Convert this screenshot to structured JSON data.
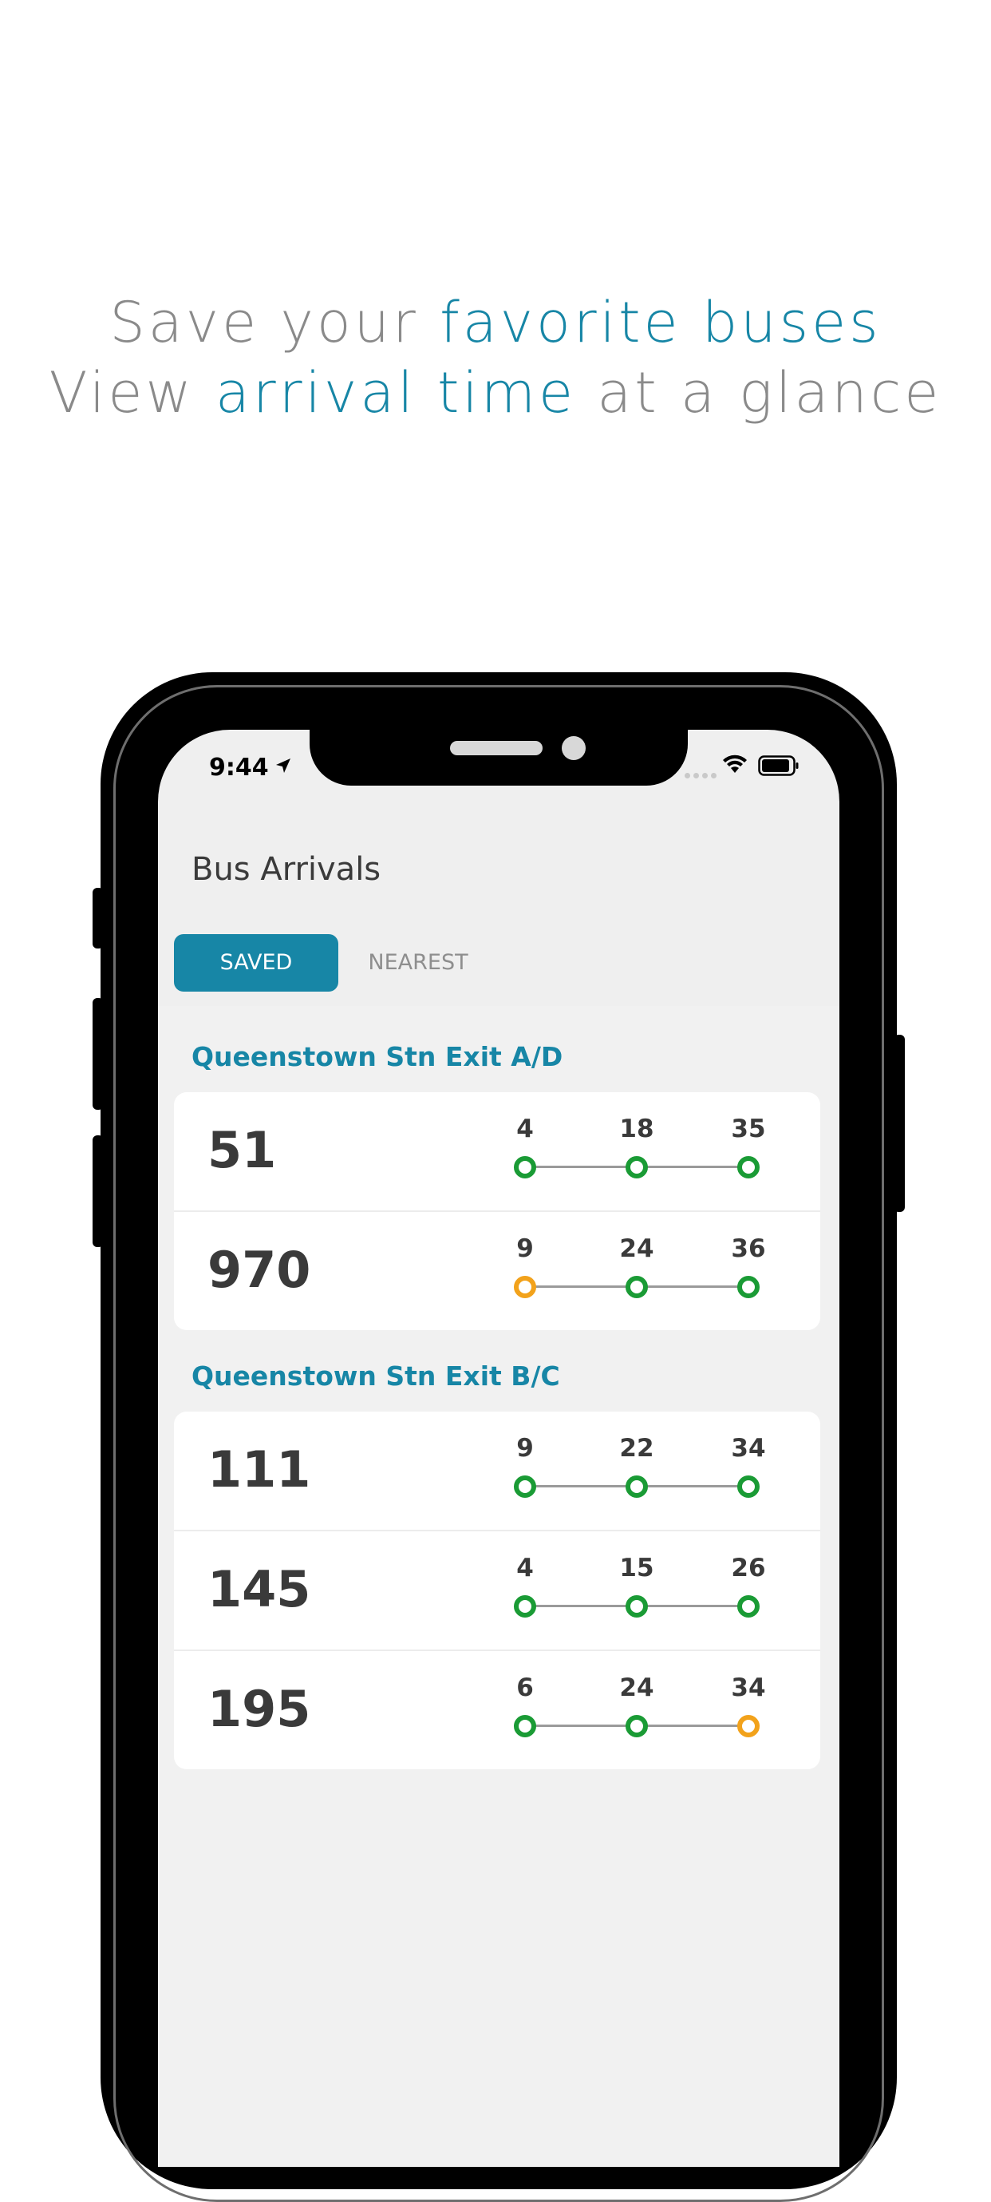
{
  "headline": {
    "line1_a": "Save your ",
    "line1_b": "favorite buses",
    "line2_a": "View ",
    "line2_b": "arrival time",
    "line2_c": " at a glance"
  },
  "status_bar": {
    "time": "9:44"
  },
  "app": {
    "title": "Bus Arrivals",
    "tabs": {
      "saved": "SAVED",
      "nearest": "NEAREST"
    }
  },
  "stops": [
    {
      "name": "Queenstown Stn Exit A/D",
      "services": [
        {
          "number": "51",
          "arrivals": [
            "4",
            "18",
            "35"
          ],
          "status": [
            "ok",
            "ok",
            "ok"
          ]
        },
        {
          "number": "970",
          "arrivals": [
            "9",
            "24",
            "36"
          ],
          "status": [
            "late",
            "ok",
            "ok"
          ]
        }
      ]
    },
    {
      "name": "Queenstown Stn Exit B/C",
      "services": [
        {
          "number": "111",
          "arrivals": [
            "9",
            "22",
            "34"
          ],
          "status": [
            "ok",
            "ok",
            "ok"
          ]
        },
        {
          "number": "145",
          "arrivals": [
            "4",
            "15",
            "26"
          ],
          "status": [
            "ok",
            "ok",
            "ok"
          ]
        },
        {
          "number": "195",
          "arrivals": [
            "6",
            "24",
            "34"
          ],
          "status": [
            "ok",
            "ok",
            "late"
          ]
        }
      ]
    }
  ],
  "colors": {
    "accent": "#1786a6",
    "on_time": "#1a9b35",
    "delayed": "#f2a21b"
  }
}
